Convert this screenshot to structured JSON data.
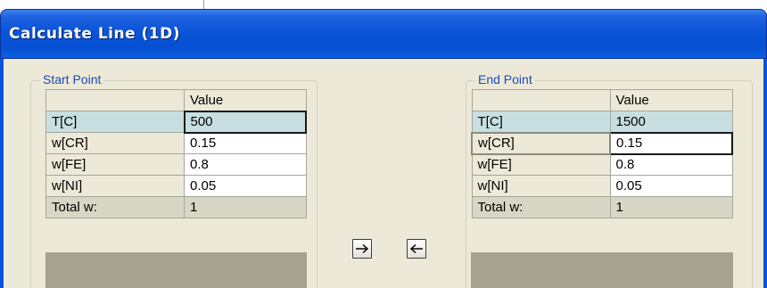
{
  "window": {
    "title": "Calculate Line (1D)"
  },
  "start_point": {
    "legend": "Start Point",
    "header": {
      "name": "",
      "value": "Value"
    },
    "rows": [
      {
        "name": "T[C]",
        "value": "500"
      },
      {
        "name": "w[CR]",
        "value": "0.15"
      },
      {
        "name": "w[FE]",
        "value": "0.8"
      },
      {
        "name": "w[NI]",
        "value": "0.05"
      }
    ],
    "total": {
      "name": "Total w:",
      "value": "1"
    }
  },
  "end_point": {
    "legend": "End Point",
    "header": {
      "name": "",
      "value": "Value"
    },
    "rows": [
      {
        "name": "T[C]",
        "value": "1500"
      },
      {
        "name": "w[CR]",
        "value": "0.15"
      },
      {
        "name": "w[FE]",
        "value": "0.8"
      },
      {
        "name": "w[NI]",
        "value": "0.05"
      }
    ],
    "total": {
      "name": "Total w:",
      "value": "1"
    }
  },
  "buttons": {
    "copy_right_icon": "arrow-right-icon",
    "copy_left_icon": "arrow-left-icon"
  },
  "colors": {
    "title_bar": "#0a54d8",
    "client_bg": "#ece9d8",
    "legend_text": "#1f47b8",
    "selected_row": "#c8dfe1",
    "total_row": "#d7d7c5"
  }
}
